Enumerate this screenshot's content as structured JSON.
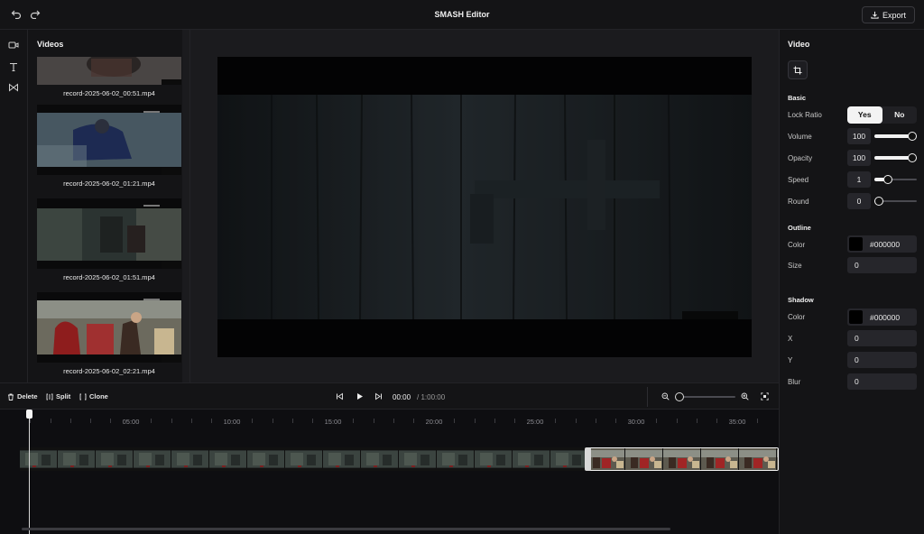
{
  "app": {
    "title": "SMASH Editor",
    "export_label": "Export"
  },
  "rail": {
    "icons": [
      "video-icon",
      "text-icon",
      "transition-icon"
    ]
  },
  "videos": {
    "title": "Videos",
    "items": [
      {
        "name": "record-2025-06-02_00:51.mp4"
      },
      {
        "name": "record-2025-06-02_01:21.mp4"
      },
      {
        "name": "record-2025-06-02_01:51.mp4"
      },
      {
        "name": "record-2025-06-02_02:21.mp4"
      }
    ]
  },
  "properties": {
    "title": "Video",
    "basic": {
      "heading": "Basic",
      "lock_ratio": {
        "label": "Lock Ratio",
        "yes": "Yes",
        "no": "No",
        "selected": "Yes"
      },
      "volume": {
        "label": "Volume",
        "value": "100",
        "level": 1.0
      },
      "opacity": {
        "label": "Opacity",
        "value": "100",
        "level": 1.0
      },
      "speed": {
        "label": "Speed",
        "value": "1",
        "level": 0.28
      },
      "round": {
        "label": "Round",
        "value": "0",
        "level": 0.0
      }
    },
    "outline": {
      "heading": "Outline",
      "color_label": "Color",
      "color_value": "#000000",
      "size_label": "Size",
      "size_value": "0"
    },
    "shadow": {
      "heading": "Shadow",
      "color_label": "Color",
      "color_value": "#000000",
      "x_label": "X",
      "x_value": "0",
      "y_label": "Y",
      "y_value": "0",
      "blur_label": "Blur",
      "blur_value": "0"
    }
  },
  "toolbar": {
    "delete_label": "Delete",
    "split_label": "Split",
    "clone_label": "Clone",
    "current_time": "00:00",
    "total_time": "/ 1:00:00",
    "zoom_level": 0.0
  },
  "timeline": {
    "ticks": [
      "05:00",
      "10:00",
      "15:00",
      "20:00",
      "25:00",
      "30:00",
      "35:00"
    ]
  }
}
